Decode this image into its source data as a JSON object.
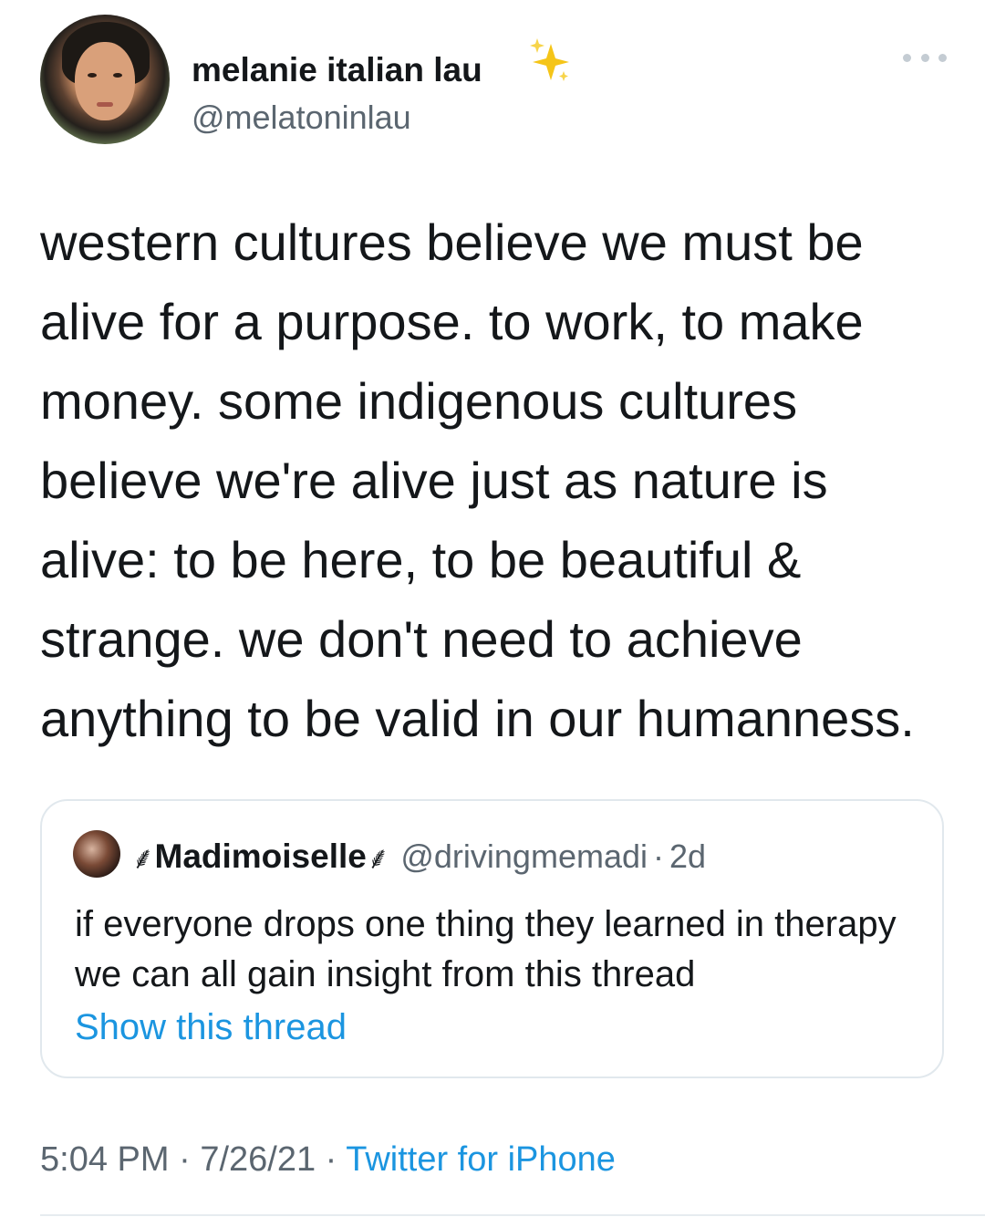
{
  "tweet": {
    "display_name": "melanie italian lau",
    "name_emoji_icon": "sparkles-icon",
    "handle": "@melatoninlau",
    "more_icon": "more-options-icon",
    "text": "western cultures believe we must be alive for a purpose. to work, to make money. some indigenous cultures believe we're alive just as nature is alive: to be here, to be beautiful & strange. we don't need to achieve anything to be valid in our humanness.",
    "time": "5:04 PM",
    "date": "7/26/21",
    "separator": "·",
    "source": "Twitter for iPhone"
  },
  "quote": {
    "name_prefix_glyph": "⸙",
    "name": "Madimoiselle",
    "name_suffix_glyph": "⸙",
    "handle": "@drivingmemadi",
    "separator": "·",
    "age": "2d",
    "text": "if everyone drops one thing they learned in therapy we can all gain insight from this thread",
    "link": "Show this thread"
  },
  "colors": {
    "text": "#14171a",
    "secondary": "#5b6670",
    "link": "#1b95e0",
    "border": "#e1e8ed"
  }
}
